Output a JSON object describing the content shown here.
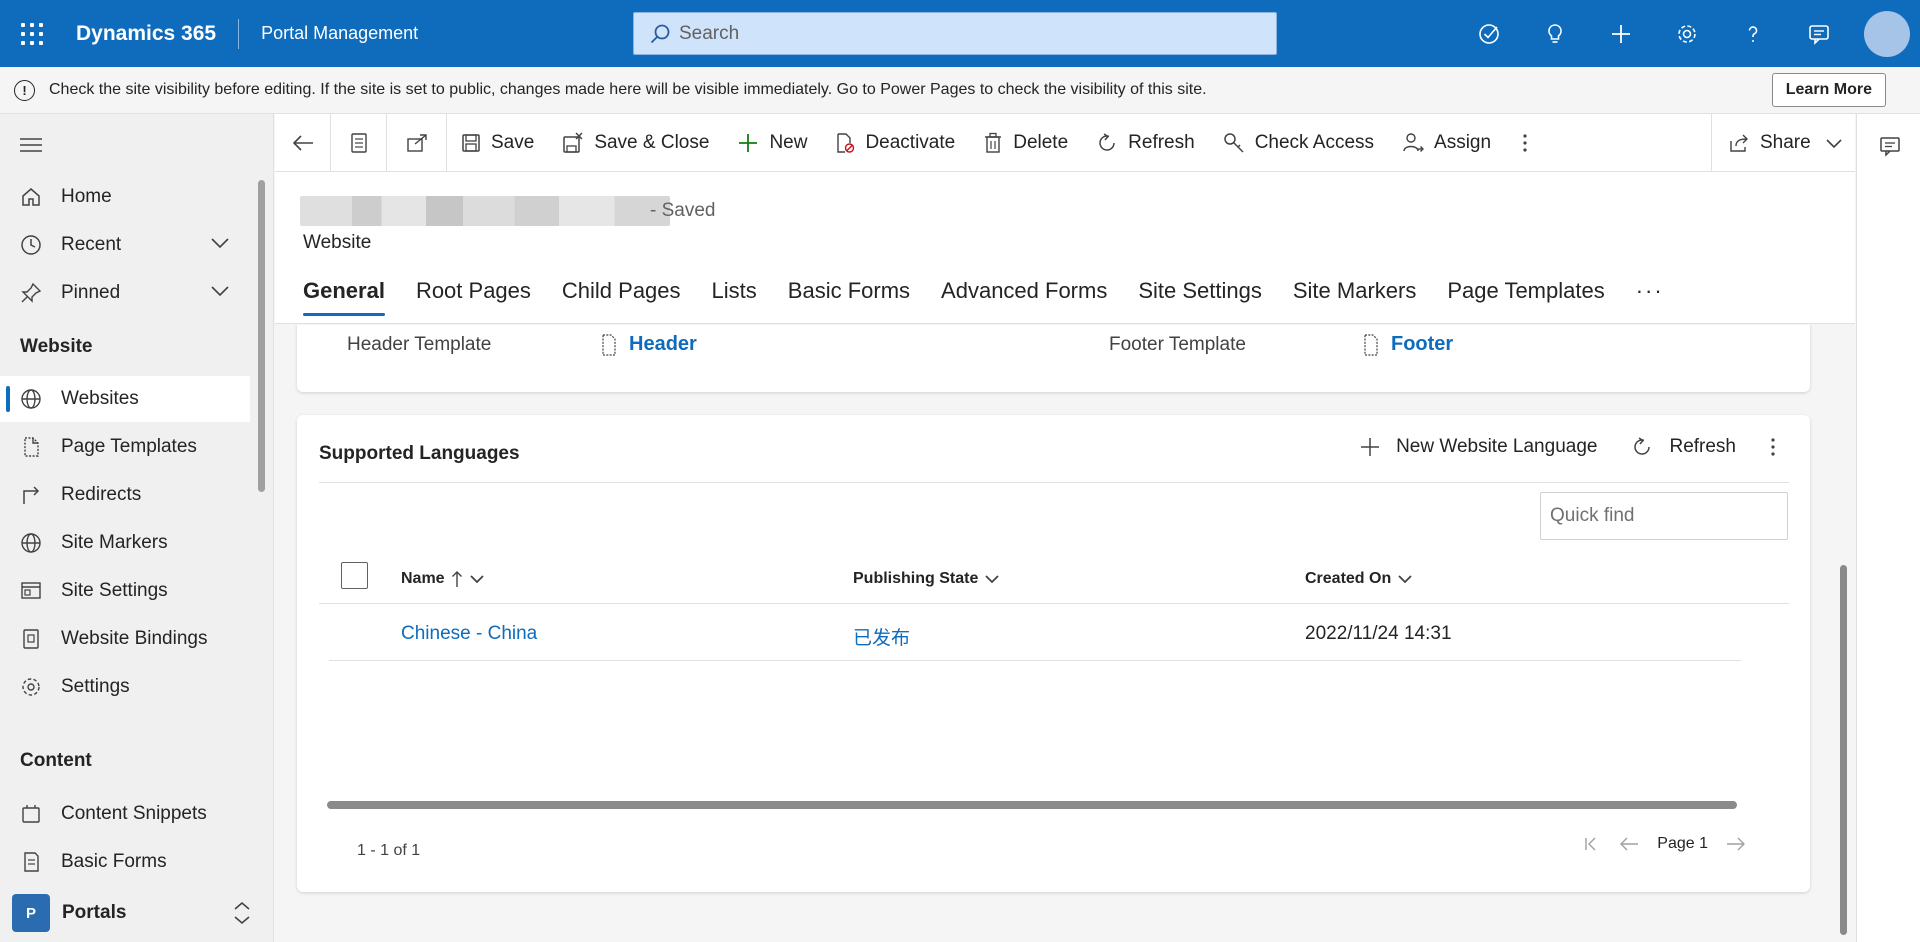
{
  "topbar": {
    "brand": "Dynamics 365",
    "app_name": "Portal Management",
    "search_placeholder": "Search"
  },
  "notice": {
    "message": "Check the site visibility before editing. If the site is set to public, changes made here will be visible immediately. Go to Power Pages to check the visibility of this site.",
    "learn_more": "Learn More"
  },
  "sidebar": {
    "items": [
      {
        "label": "Home",
        "icon": "home-icon"
      },
      {
        "label": "Recent",
        "icon": "clock-icon"
      },
      {
        "label": "Pinned",
        "icon": "pin-icon"
      }
    ],
    "section_website": "Website",
    "website_items": [
      {
        "label": "Websites",
        "icon": "globe-icon",
        "active": true
      },
      {
        "label": "Page Templates",
        "icon": "page-template-icon"
      },
      {
        "label": "Redirects",
        "icon": "redirect-icon"
      },
      {
        "label": "Site Markers",
        "icon": "globe-icon"
      },
      {
        "label": "Site Settings",
        "icon": "site-settings-icon"
      },
      {
        "label": "Website Bindings",
        "icon": "binding-icon"
      },
      {
        "label": "Settings",
        "icon": "gear-icon"
      }
    ],
    "section_content": "Content",
    "content_items": [
      {
        "label": "Content Snippets",
        "icon": "snippet-icon"
      },
      {
        "label": "Basic Forms",
        "icon": "form-icon"
      }
    ],
    "area": {
      "badge": "P",
      "label": "Portals"
    }
  },
  "commandbar": {
    "save": "Save",
    "save_close": "Save & Close",
    "new": "New",
    "deactivate": "Deactivate",
    "delete": "Delete",
    "refresh": "Refresh",
    "check_access": "Check Access",
    "assign": "Assign",
    "share": "Share"
  },
  "record": {
    "status": "- Saved",
    "entity": "Website",
    "tabs": [
      "General",
      "Root Pages",
      "Child Pages",
      "Lists",
      "Basic Forms",
      "Advanced Forms",
      "Site Settings",
      "Site Markers",
      "Page Templates"
    ],
    "tab_more": "···"
  },
  "form": {
    "header_template_label": "Header Template",
    "header_template_value": "Header",
    "footer_template_label": "Footer Template",
    "footer_template_value": "Footer"
  },
  "languages": {
    "title": "Supported Languages",
    "new_label": "New Website Language",
    "refresh_label": "Refresh",
    "quick_find_placeholder": "Quick find",
    "columns": [
      "Name",
      "Publishing State",
      "Created On"
    ],
    "rows": [
      {
        "name": "Chinese - China",
        "state": "已发布",
        "created": "2022/11/24 14:31"
      }
    ],
    "count": "1 - 1 of 1",
    "page": "Page 1"
  },
  "colors": {
    "brand": "#0f6cbd",
    "search_bg": "#cfe4fa"
  }
}
